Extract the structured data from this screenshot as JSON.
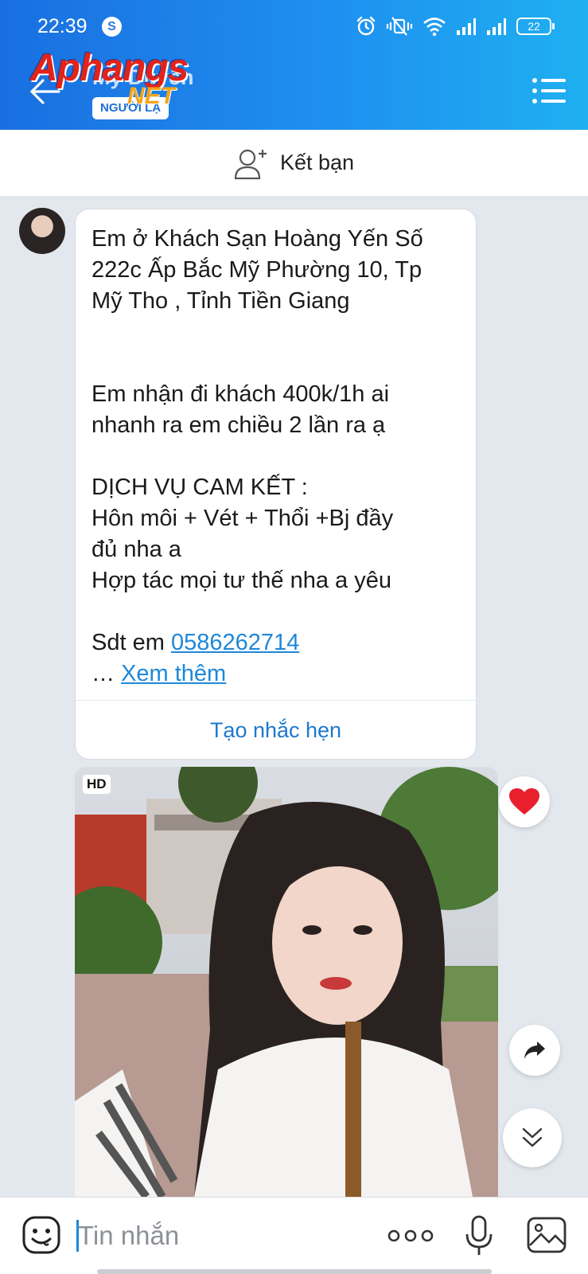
{
  "status_bar": {
    "time": "22:39",
    "app_badge": "S",
    "battery": "22"
  },
  "header": {
    "contact_name": "Mỹ Duyên",
    "stranger_badge": "NGƯỜI LẠ",
    "watermark": "Aphangs",
    "watermark_sub": "NET"
  },
  "add_friend": {
    "label": "Kết bạn"
  },
  "message": {
    "lines": [
      "Em ở Khách Sạn Hoàng Yến Số",
      "222c Ấp Bắc Mỹ Phường 10, Tp",
      "Mỹ Tho , Tỉnh Tiền Giang",
      "",
      "",
      "Em nhận đi khách 400k/1h ai",
      "nhanh ra em chiều 2 lần ra ạ",
      "",
      "DỊCH VỤ CAM KẾT :",
      "Hôn môi + Vét + Thổi +Bj  đầy",
      "đủ nha a",
      "Hợp tác mọi tư thế nha a yêu",
      ""
    ],
    "phone_prefix": "Sdt em ",
    "phone": "0586262714",
    "ellipsis": "… ",
    "see_more": "Xem thêm",
    "reminder": "Tạo nhắc hẹn"
  },
  "photo": {
    "badge": "HD"
  },
  "input": {
    "placeholder": "Tin nhắn"
  },
  "colors": {
    "accent": "#1e88d8",
    "header_start": "#1a6fe0",
    "header_end": "#1fb0f0",
    "heart": "#e8202e"
  },
  "icons": [
    "back-arrow-icon",
    "menu-icon",
    "add-friend-icon",
    "heart-icon",
    "share-icon",
    "scroll-down-icon",
    "emoji-icon",
    "more-icon",
    "mic-icon",
    "image-icon"
  ]
}
